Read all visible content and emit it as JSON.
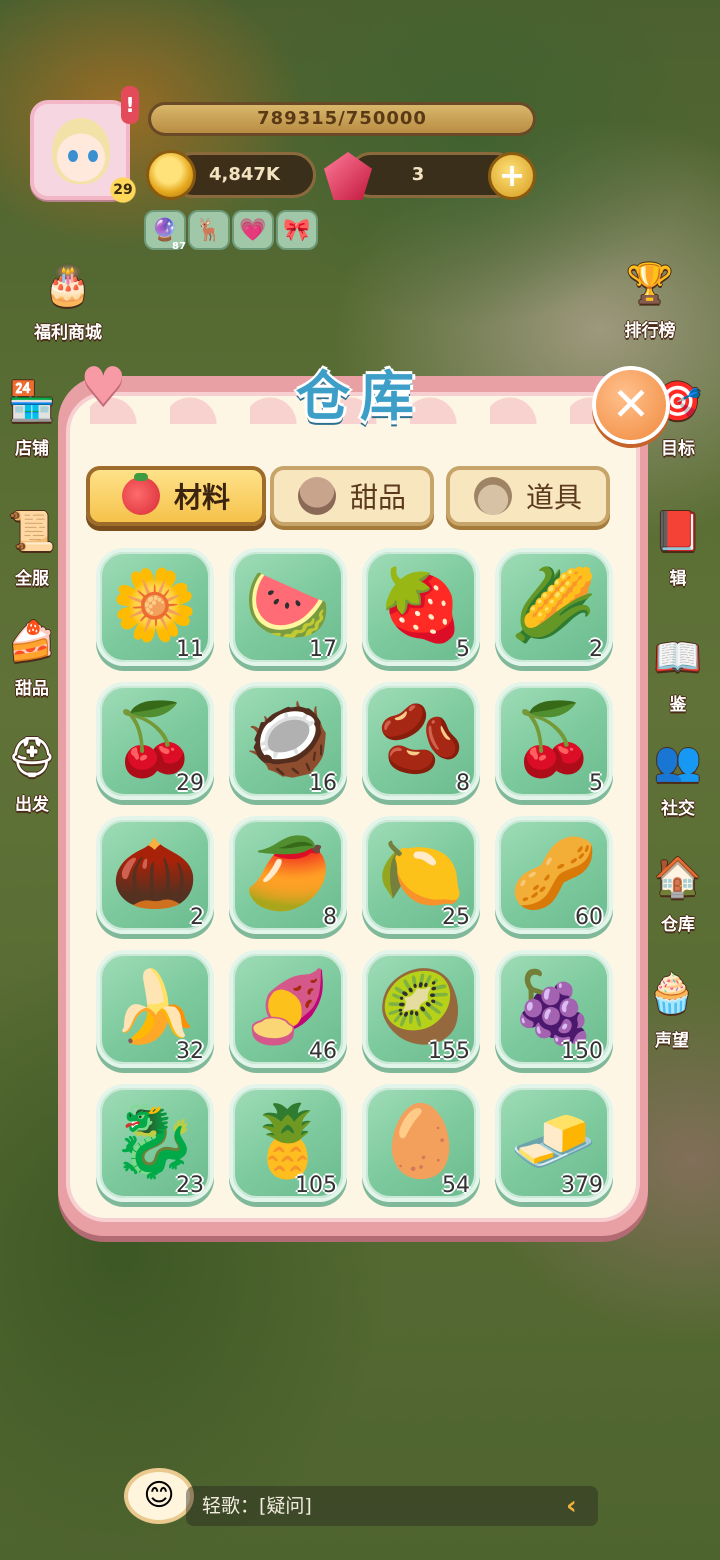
{
  "hud": {
    "level": "29",
    "alert": "!",
    "xp_text": "789315/750000",
    "xp_fill": 1.0,
    "coins": "4,847K",
    "gems": "3",
    "plus": "+",
    "buffs": [
      {
        "icon": "🔮",
        "count": "87"
      },
      {
        "icon": "🦌"
      },
      {
        "icon": "💗"
      },
      {
        "icon": "🎀"
      }
    ]
  },
  "left_menu": [
    {
      "label": "福利商城",
      "icon": "🎂"
    },
    {
      "label": "店铺",
      "icon": "🏪"
    },
    {
      "label": "全服",
      "icon": "📜"
    },
    {
      "label": "甜品",
      "icon": "🍰"
    },
    {
      "label": "出发",
      "icon": "⛑"
    }
  ],
  "right_menu": [
    {
      "label": "排行榜",
      "icon": "🏆"
    },
    {
      "label": "目标",
      "icon": "🎯"
    },
    {
      "label": "辑",
      "icon": "📕"
    },
    {
      "label": "鉴",
      "icon": "📖"
    },
    {
      "label": "社交",
      "icon": "👥"
    },
    {
      "label": "仓库",
      "icon": "🏠"
    },
    {
      "label": "声望",
      "icon": "🧁"
    }
  ],
  "modal": {
    "title": "仓库",
    "close": "✕",
    "tabs": [
      {
        "label": "材料",
        "active": true
      },
      {
        "label": "甜品",
        "active": false
      },
      {
        "label": "道具",
        "active": false
      }
    ],
    "items": [
      {
        "icon": "🌼",
        "qty": "11"
      },
      {
        "icon": "🍉",
        "qty": "17"
      },
      {
        "icon": "🍓",
        "qty": "5"
      },
      {
        "icon": "🌽",
        "qty": "2"
      },
      {
        "icon": "🍒",
        "qty": "29"
      },
      {
        "icon": "🥥",
        "qty": "16"
      },
      {
        "icon": "🫘",
        "qty": "8"
      },
      {
        "icon": "🍒",
        "qty": "5"
      },
      {
        "icon": "🌰",
        "qty": "2"
      },
      {
        "icon": "🥭",
        "qty": "8"
      },
      {
        "icon": "🍋",
        "qty": "25"
      },
      {
        "icon": "🥜",
        "qty": "60"
      },
      {
        "icon": "🍌",
        "qty": "32"
      },
      {
        "icon": "🍠",
        "qty": "46"
      },
      {
        "icon": "🥝",
        "qty": "155"
      },
      {
        "icon": "🍇",
        "qty": "150"
      },
      {
        "icon": "🐉",
        "qty": "23"
      },
      {
        "icon": "🍍",
        "qty": "105"
      },
      {
        "icon": "🥚",
        "qty": "54"
      },
      {
        "icon": "🧈",
        "qty": "379"
      }
    ]
  },
  "chat": {
    "text": "轻歌：[疑问]",
    "bubble_icon": "😊",
    "arrow": "‹"
  }
}
